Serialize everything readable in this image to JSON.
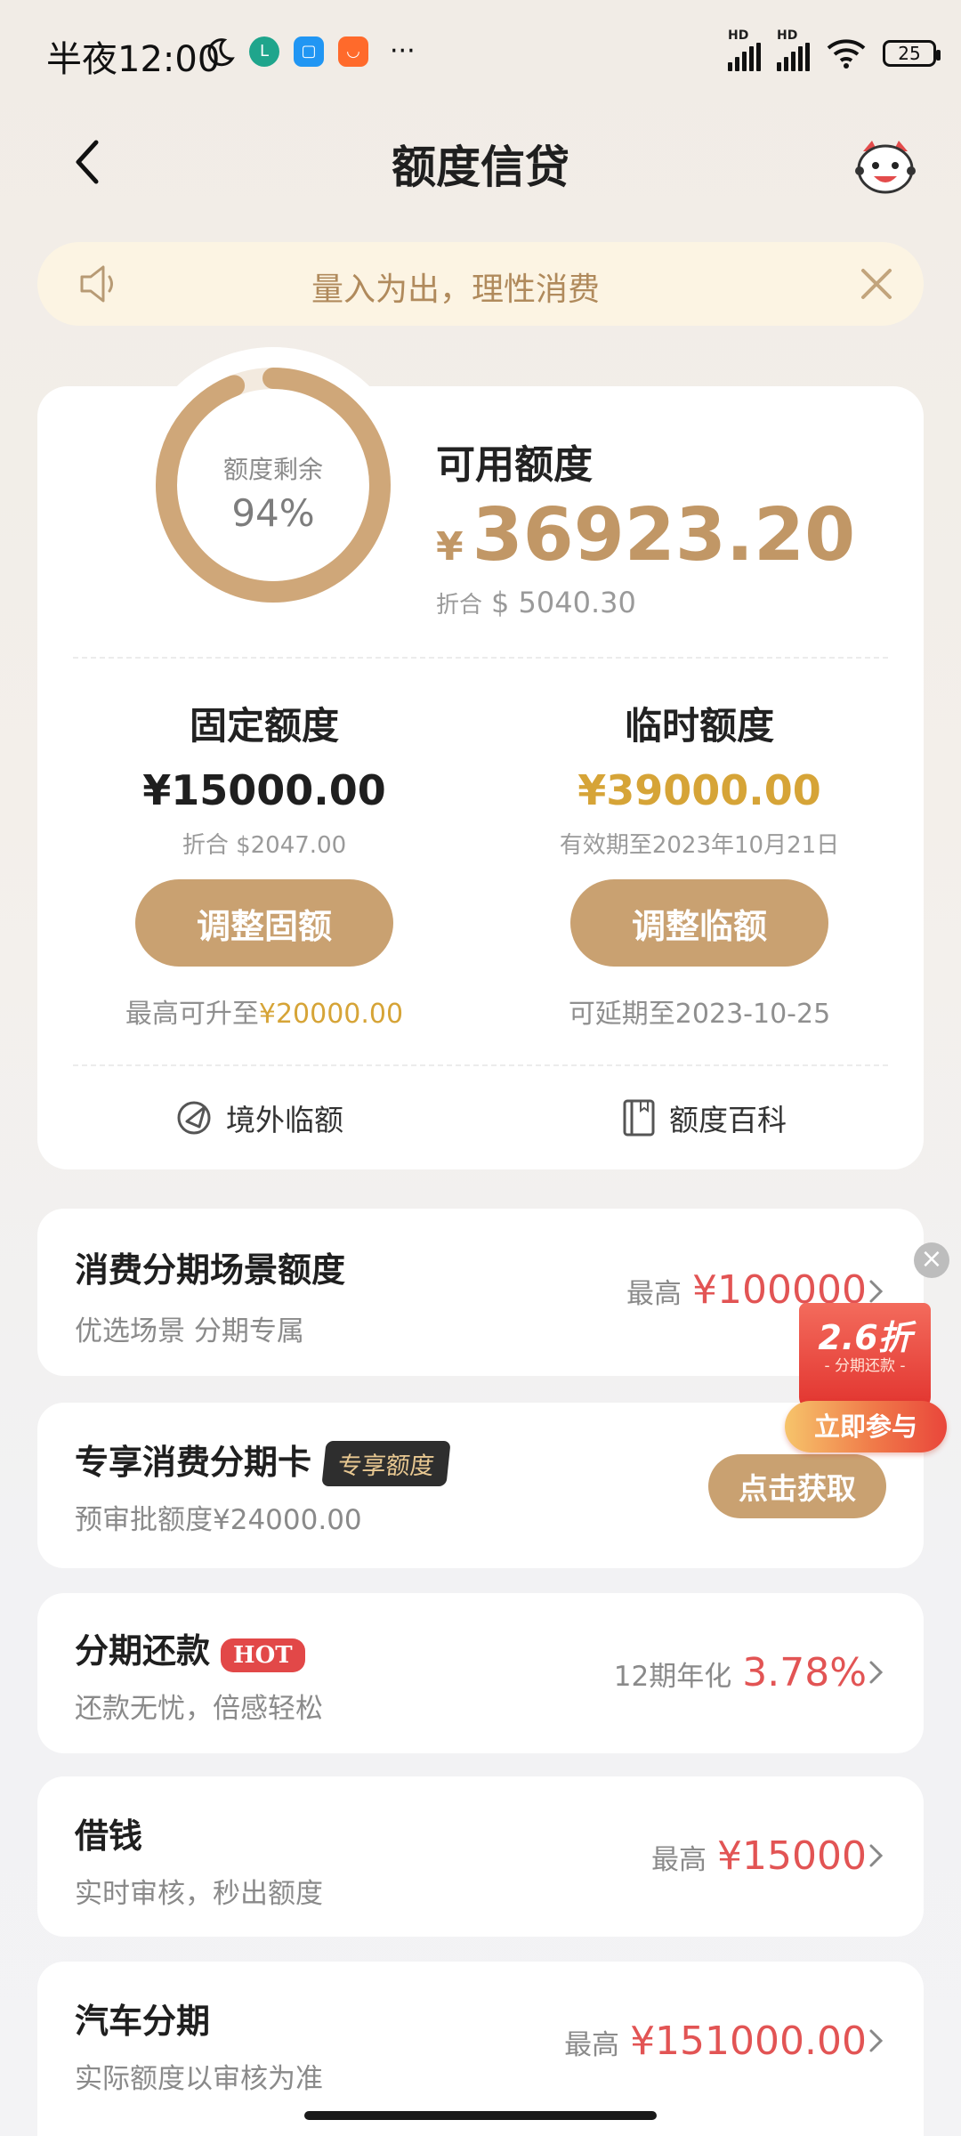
{
  "status_bar": {
    "time": "半夜12:00",
    "network_labels": [
      "HD",
      "HD"
    ],
    "battery": "25",
    "more": "···"
  },
  "nav": {
    "title": "额度信贷"
  },
  "notice": {
    "text": "量入为出，理性消费"
  },
  "credit": {
    "ring_label": "额度剩余",
    "ring_percent": "94%",
    "ring_fraction": 0.94,
    "available_title": "可用额度",
    "currency_symbol": "¥",
    "available_amount": "36923.20",
    "converted_prefix": "折合",
    "converted_amount": "$ 5040.30",
    "fixed": {
      "title": "固定额度",
      "amount": "¥15000.00",
      "converted": "折合 $2047.00",
      "button": "调整固额",
      "note_prefix": "最高可升至",
      "note_value": "¥20000.00"
    },
    "temporary": {
      "title": "临时额度",
      "amount": "¥39000.00",
      "validity": "有效期至2023年10月21日",
      "button": "调整临额",
      "note": "可延期至2023-10-25"
    },
    "links": [
      {
        "label": "境外临额",
        "icon": "plane-icon"
      },
      {
        "label": "额度百科",
        "icon": "book-icon"
      }
    ]
  },
  "items": [
    {
      "title": "消费分期场景额度",
      "subtitle": "优选场景 分期专属",
      "key": "最高",
      "value": "¥100000"
    },
    {
      "title": "专享消费分期卡",
      "tag": "专享额度",
      "subtitle": "预审批额度¥24000.00",
      "button": "点击获取"
    },
    {
      "title": "分期还款",
      "tag": "HOT",
      "subtitle": "还款无忧，倍感轻松",
      "key": "12期年化",
      "value": "3.78%"
    },
    {
      "title": "借钱",
      "subtitle": "实时审核，秒出额度",
      "key": "最高",
      "value": "¥15000"
    },
    {
      "title": "汽车分期",
      "subtitle": "实际额度以审核为准",
      "key": "最高",
      "value": "¥151000.00"
    }
  ],
  "promo": {
    "discount": "2.6折",
    "subtitle": "- 分期还款 -",
    "button": "立即参与",
    "close": "×"
  },
  "colors": {
    "gold": "#c9a171",
    "amount_gold": "#c19766",
    "temp_yellow": "#d6a437",
    "red": "#e25454"
  }
}
